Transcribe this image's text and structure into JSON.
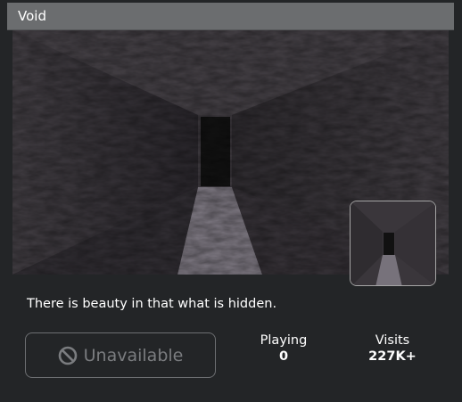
{
  "header": {
    "title": "Void"
  },
  "description": "There is beauty in that what is hidden.",
  "play_button": {
    "label": "Unavailable",
    "icon": "prohibited-icon"
  },
  "stats": {
    "playing": {
      "label": "Playing",
      "value": "0"
    },
    "visits": {
      "label": "Visits",
      "value": "227K+"
    }
  },
  "colors": {
    "background": "#232527",
    "title_bar": "#6b6d6f",
    "disabled_text": "#7a7c7f"
  }
}
